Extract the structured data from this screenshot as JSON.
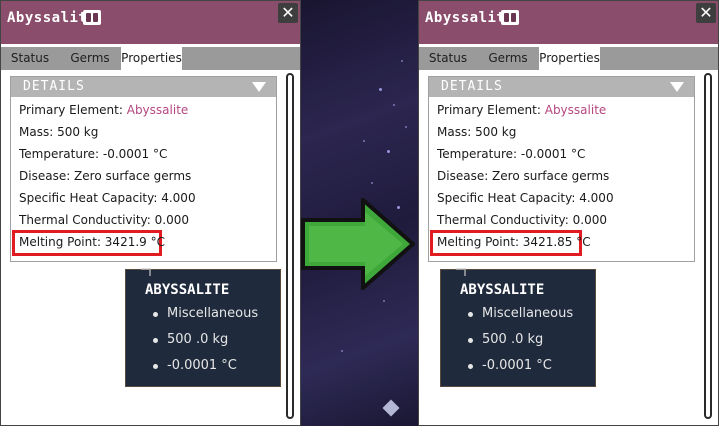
{
  "left": {
    "title": "Abyssalite",
    "close_label": "✕",
    "tabs": [
      "Status",
      "Germs",
      "Properties"
    ],
    "details_header": "DETAILS",
    "primary_label": "Primary Element: ",
    "primary_value": "Abyssalite",
    "mass": "Mass: 500 kg",
    "temperature": "Temperature: -0.0001 °C",
    "disease": "Disease: Zero surface germs",
    "heat_capacity": "Specific Heat Capacity: 4.000",
    "conductivity": "Thermal Conductivity: 0.000",
    "melting_point": "Melting Point: 3421.9 °C",
    "tooltip": {
      "title": "ABYSSALITE",
      "items": [
        "Miscellaneous",
        "500 .0  kg",
        "-0.0001 °C"
      ]
    }
  },
  "right": {
    "title": "Abyssalite",
    "close_label": "✕",
    "tabs": [
      "Status",
      "Germs",
      "Properties"
    ],
    "details_header": "DETAILS",
    "primary_label": "Primary Element: ",
    "primary_value": "Abyssalite",
    "mass": "Mass: 500 kg",
    "temperature": "Temperature: -0.0001 °C",
    "disease": "Disease: Zero surface germs",
    "heat_capacity": "Specific Heat Capacity: 4.000",
    "conductivity": "Thermal Conductivity: 0.000",
    "melting_point": "Melting Point: 3421.85 °C",
    "tooltip": {
      "title": "ABYSSALITE",
      "items": [
        "Miscellaneous",
        "500 .0  kg",
        "-0.0001 °C"
      ]
    }
  },
  "colors": {
    "titlebar": "#8a4d6c",
    "link": "#b5477f",
    "highlight": "#e21b23",
    "arrow": "#3fa83a",
    "tooltip_bg": "#1f2a3c"
  },
  "icons": {
    "codex": "book-icon",
    "close": "close-icon",
    "collapse": "chevron-down-icon",
    "arrow": "arrow-right-icon"
  }
}
